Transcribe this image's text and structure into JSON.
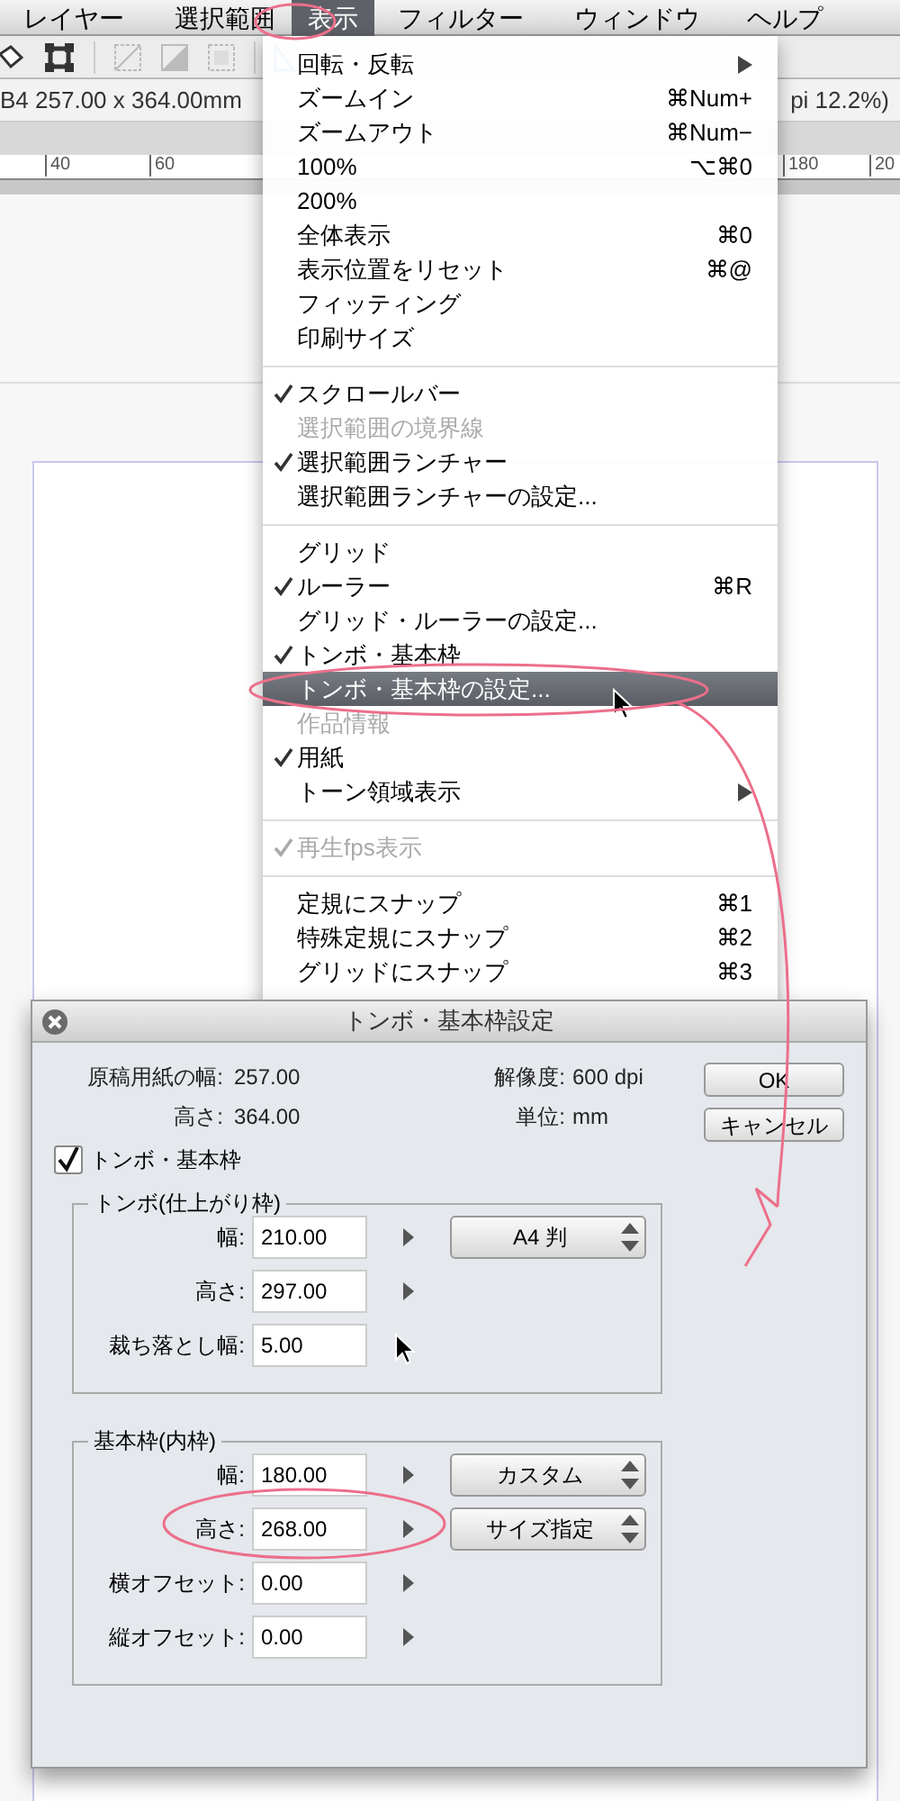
{
  "menubar": [
    {
      "label": "レイヤー",
      "selected": false
    },
    {
      "label": "選択範囲",
      "selected": false
    },
    {
      "label": "表示",
      "selected": true
    },
    {
      "label": "フィルター",
      "selected": false
    },
    {
      "label": "ウィンドウ",
      "selected": false
    },
    {
      "label": "ヘルプ",
      "selected": false
    }
  ],
  "info_bar": {
    "left_text": "B4 257.00 x 364.00mm",
    "right_text": "pi 12.2%)"
  },
  "ruler": {
    "left_labels": [
      "40",
      "60"
    ],
    "right_labels": [
      "180",
      "20"
    ]
  },
  "view_menu": {
    "groups": [
      [
        {
          "label": "回転・反転",
          "checked": false,
          "disabled": false,
          "selected": false,
          "submenu": true
        },
        {
          "label": "ズームイン",
          "shortcut": "⌘Num+",
          "checked": false,
          "disabled": false,
          "selected": false
        },
        {
          "label": "ズームアウト",
          "shortcut": "⌘Num−",
          "checked": false,
          "disabled": false,
          "selected": false
        },
        {
          "label": "100%",
          "shortcut": "⌥⌘0",
          "checked": false,
          "disabled": false,
          "selected": false
        },
        {
          "label": "200%",
          "checked": false,
          "disabled": false,
          "selected": false
        },
        {
          "label": "全体表示",
          "shortcut": "⌘0",
          "checked": false,
          "disabled": false,
          "selected": false
        },
        {
          "label": "表示位置をリセット",
          "shortcut": "⌘@",
          "checked": false,
          "disabled": false,
          "selected": false
        },
        {
          "label": "フィッティング",
          "checked": false,
          "disabled": false,
          "selected": false
        },
        {
          "label": "印刷サイズ",
          "checked": false,
          "disabled": false,
          "selected": false
        }
      ],
      [
        {
          "label": "スクロールバー",
          "checked": true,
          "disabled": false,
          "selected": false
        },
        {
          "label": "選択範囲の境界線",
          "checked": false,
          "disabled": true,
          "selected": false
        },
        {
          "label": "選択範囲ランチャー",
          "checked": true,
          "disabled": false,
          "selected": false
        },
        {
          "label": "選択範囲ランチャーの設定...",
          "checked": false,
          "disabled": false,
          "selected": false
        }
      ],
      [
        {
          "label": "グリッド",
          "checked": false,
          "disabled": false,
          "selected": false
        },
        {
          "label": "ルーラー",
          "shortcut": "⌘R",
          "checked": true,
          "disabled": false,
          "selected": false
        },
        {
          "label": "グリッド・ルーラーの設定...",
          "checked": false,
          "disabled": false,
          "selected": false
        },
        {
          "label": "トンボ・基本枠",
          "checked": true,
          "disabled": false,
          "selected": false
        },
        {
          "label": "トンボ・基本枠の設定...",
          "checked": false,
          "disabled": false,
          "selected": true
        },
        {
          "label": "作品情報",
          "checked": false,
          "disabled": true,
          "selected": false
        },
        {
          "label": "用紙",
          "checked": true,
          "disabled": false,
          "selected": false
        },
        {
          "label": "トーン領域表示",
          "checked": false,
          "disabled": false,
          "selected": false,
          "submenu": true
        }
      ],
      [
        {
          "label": "再生fps表示",
          "checked": true,
          "disabled": true,
          "selected": false
        }
      ],
      [
        {
          "label": "定規にスナップ",
          "shortcut": "⌘1",
          "checked": false,
          "disabled": false,
          "selected": false
        },
        {
          "label": "特殊定規にスナップ",
          "shortcut": "⌘2",
          "checked": false,
          "disabled": false,
          "selected": false
        },
        {
          "label": "グリッドにスナップ",
          "shortcut": "⌘3",
          "checked": false,
          "disabled": false,
          "selected": false
        }
      ]
    ]
  },
  "dialog": {
    "title": "トンボ・基本枠設定",
    "info": [
      {
        "label": "原稿用紙の幅:",
        "value": "257.00"
      },
      {
        "label": "高さ:",
        "value": "364.00"
      }
    ],
    "info_right": [
      {
        "label": "解像度:",
        "value": "600 dpi"
      },
      {
        "label": "単位:",
        "value": "mm"
      }
    ],
    "buttons": [
      "OK",
      "キャンセル"
    ],
    "checkbox": {
      "label": "トンボ・基本枠",
      "checked": true
    },
    "groups": [
      {
        "title": "トンボ(仕上がり枠)",
        "rows": [
          {
            "label": "幅:",
            "value": "210.00",
            "arrow": true,
            "popup": "A4 判"
          },
          {
            "label": "高さ:",
            "value": "297.00",
            "arrow": true
          },
          {
            "label": "裁ち落とし幅:",
            "value": "5.00",
            "arrow": false
          }
        ]
      },
      {
        "title": "基本枠(内枠)",
        "rows": [
          {
            "label": "幅:",
            "value": "180.00",
            "arrow": true,
            "popup": "カスタム"
          },
          {
            "label": "高さ:",
            "value": "268.00",
            "arrow": true,
            "popup": "サイズ指定"
          },
          {
            "label": "横オフセット:",
            "value": "0.00",
            "arrow": true
          },
          {
            "label": "縦オフセット:",
            "value": "0.00",
            "arrow": true
          }
        ]
      }
    ]
  }
}
